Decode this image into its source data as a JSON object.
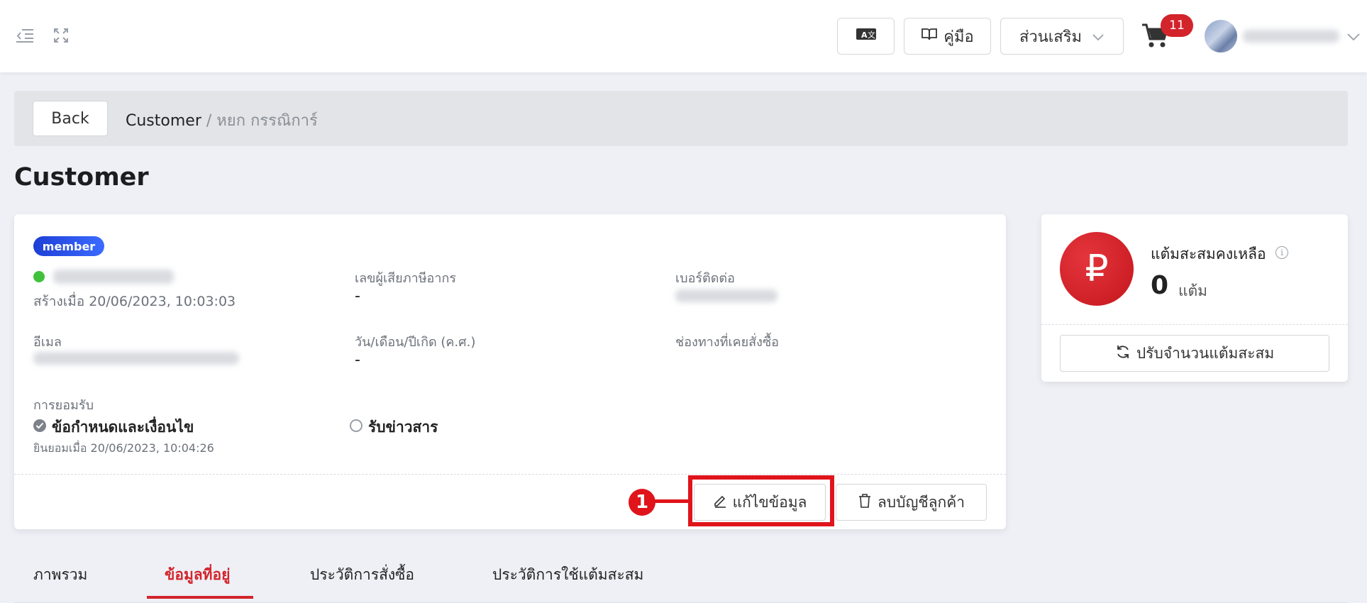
{
  "header": {
    "manual_label": "คู่มือ",
    "addons_label": "ส่วนเสริม",
    "cart_count": "11"
  },
  "breadcrumb": {
    "back_label": "Back",
    "root": "Customer",
    "separator": "/",
    "current": "หยก กรรณิการ์"
  },
  "page": {
    "title": "Customer"
  },
  "customer": {
    "badge": "member",
    "created_at": "สร้างเมื่อ 20/06/2023, 10:03:03",
    "tax_id_label": "เลขผู้เสียภาษีอากร",
    "tax_id_value": "-",
    "phone_label": "เบอร์ติดต่อ",
    "email_label": "อีเมล",
    "birthdate_label": "วัน/เดือน/ปีเกิด (ค.ศ.)",
    "birthdate_value": "-",
    "channel_label": "ช่องทางที่เคยสั่งซื้อ",
    "consent_label": "การยอมรับ",
    "terms_label": "ข้อกำหนดและเงื่อนไข",
    "terms_accepted_at": "ยินยอมเมื่อ 20/06/2023, 10:04:26",
    "newsletter_label": "รับข่าวสาร"
  },
  "actions": {
    "edit_label": "แก้ไขข้อมูล",
    "delete_label": "ลบบัญชีลูกค้า",
    "annotation_number": "1"
  },
  "points": {
    "symbol": "₽",
    "title": "แต้มสะสมคงเหลือ",
    "value": "0",
    "unit": "แต้ม",
    "adjust_label": "ปรับจำนวนแต้มสะสม"
  },
  "tabs": [
    {
      "label": "ภาพรวม"
    },
    {
      "label": "ข้อมูลที่อยู่"
    },
    {
      "label": "ประวัติการสั่งซื้อ"
    },
    {
      "label": "ประวัติการใช้แต้มสะสม"
    }
  ],
  "colors": {
    "accent_red": "#d3242b",
    "member_blue": "#1e3fd6",
    "online_green": "#3fc23a"
  }
}
